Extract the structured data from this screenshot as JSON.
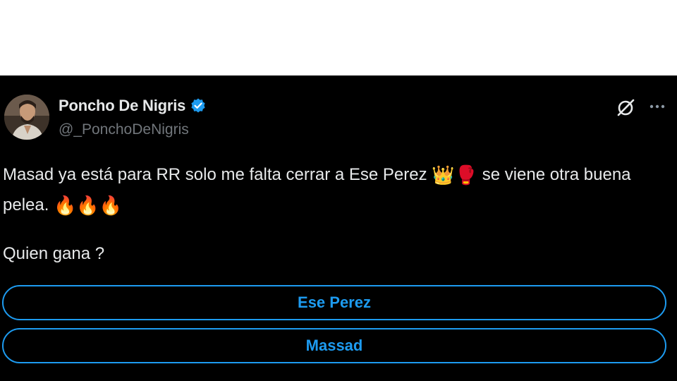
{
  "tweet": {
    "author": {
      "display_name": "Poncho De Nigris",
      "handle": "@_PonchoDeNigris",
      "verified": true,
      "avatar_icon": "avatar-photo"
    },
    "text_part1": "Masad ya está para RR solo me falta cerrar a Ese Perez",
    "text_emoji1": "👑",
    "text_emoji2": "🥊",
    "text_part2": "se viene otra buena pelea.",
    "text_emoji3": "🔥🔥🔥",
    "question": "Quien gana ?",
    "poll": {
      "options": [
        {
          "label": "Ese Perez"
        },
        {
          "label": "Massad"
        }
      ]
    },
    "actions": {
      "grok_icon": "grok-icon",
      "more_icon": "more-options-icon"
    }
  },
  "colors": {
    "background": "#000000",
    "text": "#e7e9ea",
    "secondary_text": "#71767b",
    "accent": "#1d9bf0"
  }
}
